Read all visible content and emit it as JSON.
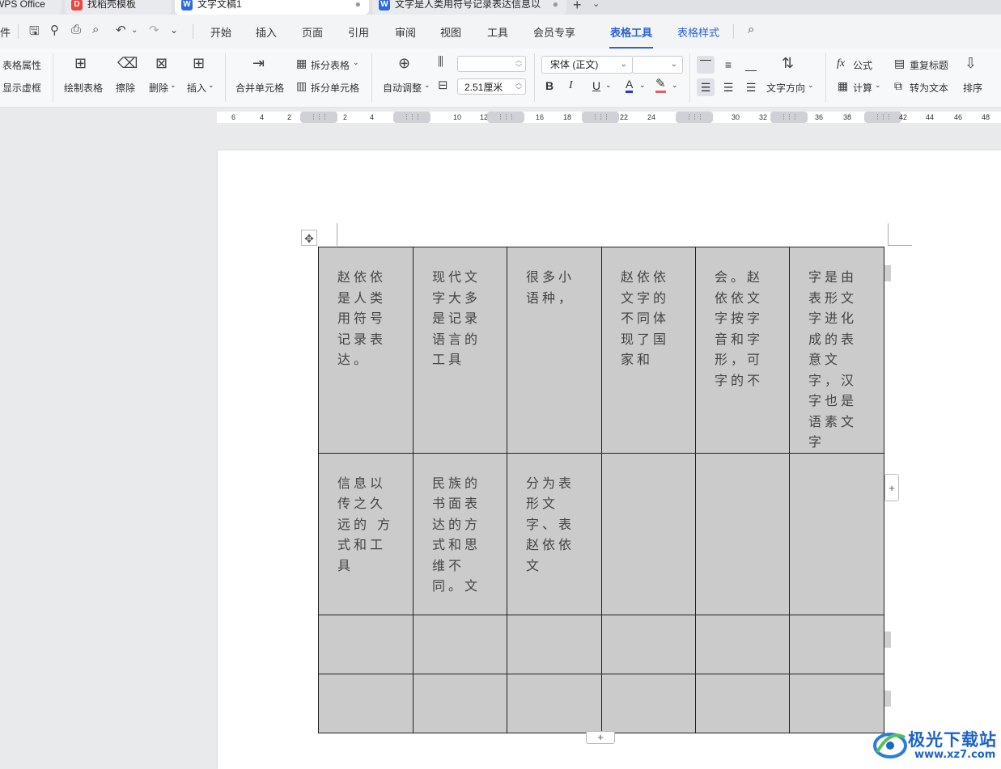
{
  "tabs": [
    {
      "label": "WPS Office",
      "icon": "wps-logo-icon",
      "active": false
    },
    {
      "label": "找稻壳模板",
      "icon": "docer-icon",
      "active": false
    },
    {
      "label": "文字文稿1",
      "icon": "wps-writer-icon",
      "active": true,
      "modified": true
    },
    {
      "label": "文字是人类用符号记录表达信息以",
      "icon": "wps-writer-icon",
      "active": false,
      "modified": true
    }
  ],
  "tab_new_label": "+",
  "menu": {
    "file_label": "件",
    "items": [
      "开始",
      "插入",
      "页面",
      "引用",
      "审阅",
      "视图",
      "工具",
      "会员专享",
      "表格工具",
      "表格样式"
    ],
    "active": "表格工具"
  },
  "ribbon": {
    "table_props": "表格属性",
    "show_gridlines": "显示虚框",
    "draw_table": "绘制表格",
    "eraser": "擦除",
    "delete": "删除",
    "insert": "插入",
    "merge_cells": "合并单元格",
    "split_table": "拆分表格",
    "split_cells": "拆分单元格",
    "autofit": "自动调整",
    "row_height_value": "",
    "col_width_value": "2.51厘米",
    "font_name": "宋体 (正文)",
    "font_size": "",
    "bold": "B",
    "italic": "I",
    "underline": "U",
    "font_color": "A",
    "text_direction": "文字方向",
    "formula": "公式",
    "calculate": "计算",
    "repeat_header": "重复标题",
    "convert_to_text": "转为文本",
    "sort": "排序"
  },
  "ruler_ticks": [
    "6",
    "4",
    "2",
    "2",
    "4",
    "10",
    "12",
    "16",
    "18",
    "22",
    "24",
    "30",
    "32",
    "36",
    "38",
    "42",
    "44",
    "46",
    "48"
  ],
  "table": {
    "rows": [
      [
        "赵依依是人类用符号记录表达。",
        "现代文字大多是记录语言的工具",
        "很多小语种，",
        "赵依依文字的不同体现了国家和",
        "会。赵依依文字按字音和字形，可字的不",
        "字是由表形文字进化成的表意文字，汉字也是语素文字"
      ],
      [
        "信息以传之久远的 方式和工具",
        "民族的书面表达的方式和思维不同。文",
        "分为表形文字、表赵依依文",
        "",
        "",
        ""
      ],
      [
        "",
        "",
        "",
        "",
        "",
        ""
      ],
      [
        "",
        "",
        "",
        "",
        "",
        ""
      ]
    ]
  },
  "watermark": {
    "name": "极光下载站",
    "url": "www.xz7.com"
  },
  "colors": {
    "accent": "#2b63d9",
    "cell_bg": "#cbcbcb",
    "watermark": "#1d64c8"
  }
}
